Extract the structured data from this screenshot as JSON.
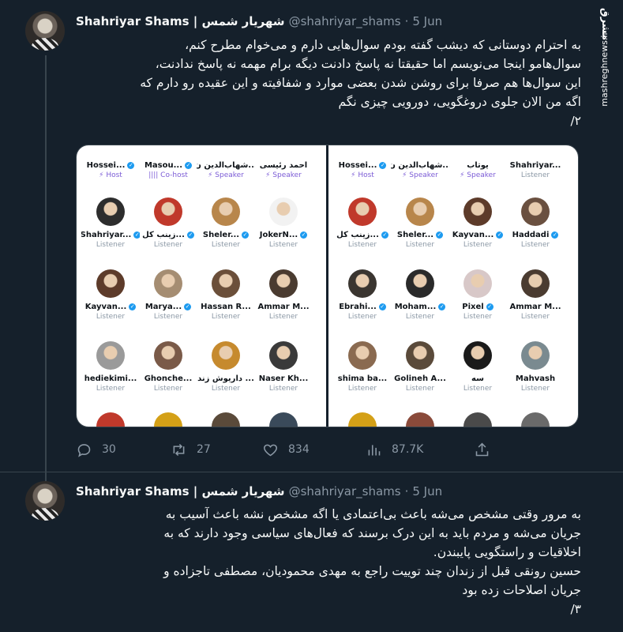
{
  "watermark": {
    "logo": "مشرق",
    "url": "mashreghnews.ir"
  },
  "tweets": [
    {
      "display_name": "Shahriyar Shams | شهریار شمس",
      "handle": "@shahriyar_shams",
      "dot": "·",
      "date": "5 Jun",
      "text": "به احترام دوستانی که دیشب گفته بودم سوال‌هایی دارم و می‌خوام مطرح کنم،\nسوال‌هامو اینجا می‌نویسم اما حقیقتا نه پاسخ دادنت دیگه برام مهمه نه پاسخ ندادنت،\nاین سوال‌ها هم صرفا برای روشن شدن بعضی موارد و شفافیته و این عقیده رو دارم که\nاگه من الان جلوی دروغگویی، دورویی چیزی نگم\n۲/",
      "actions": {
        "reply": "30",
        "retweet": "27",
        "like": "834",
        "views": "87.7K"
      }
    },
    {
      "display_name": "Shahriyar Shams | شهریار شمس",
      "handle": "@shahriyar_shams",
      "dot": "·",
      "date": "5 Jun",
      "text": "به مرور وقتی مشخص می‌شه باعث بی‌اعتمادی یا اگه مشخص نشه باعث آسیب به\nجریان می‌شه و مردم باید به این درک برسند که فعال‌های سیاسی وجود دارند که به\nاخلاقیات و راستگویی پایبندن.\nحسین رونقی قبل از زندان چند توییت راجع به مهدی محمودیان، مصطفی تاجزاده و\nجریان اصلاحات زده بود\n۳/"
    }
  ],
  "media": {
    "left_panel": [
      {
        "name": "Hossei...",
        "role": "Host",
        "verified": true,
        "color": "#3a3a3a"
      },
      {
        "name": "Masou...",
        "role": "Co-host",
        "verified": true,
        "color": "#5a4a3a"
      },
      {
        "name": "شهاب‌الدین ن...",
        "role": "Speaker",
        "verified": false,
        "color": "#7a6a5a"
      },
      {
        "name": "احمد رئیسی",
        "role": "Speaker",
        "verified": false,
        "color": "#4a4a4a"
      },
      {
        "name": "Shahriyar...",
        "role": "Listener",
        "verified": true,
        "color": "#2d2d2d"
      },
      {
        "name": "زینب کل...",
        "role": "Listener",
        "verified": true,
        "color": "#c0392b"
      },
      {
        "name": "Sheler...",
        "role": "Listener",
        "verified": true,
        "color": "#b8864b"
      },
      {
        "name": "JokerN...",
        "role": "Listener",
        "verified": true,
        "color": "#f2f2f2"
      },
      {
        "name": "Kayvan...",
        "role": "Listener",
        "verified": true,
        "color": "#5d3b2a"
      },
      {
        "name": "Marya...",
        "role": "Listener",
        "verified": true,
        "color": "#a58d72"
      },
      {
        "name": "Hassan R...",
        "role": "Listener",
        "verified": false,
        "color": "#6b4f3a"
      },
      {
        "name": "Ammar M...",
        "role": "Listener",
        "verified": false,
        "color": "#4a3b30"
      },
      {
        "name": "hediekimi...",
        "role": "Listener",
        "verified": false,
        "color": "#9a9a9a"
      },
      {
        "name": "Ghonche...",
        "role": "Listener",
        "verified": false,
        "color": "#7a5a48"
      },
      {
        "name": "داریوش زند ...",
        "role": "Listener",
        "verified": false,
        "color": "#c68a2e"
      },
      {
        "name": "Naser Kh...",
        "role": "Listener",
        "verified": false,
        "color": "#3a3a3a"
      }
    ],
    "right_panel": [
      {
        "name": "Hossei...",
        "role": "Host",
        "verified": true,
        "color": "#3a3a3a"
      },
      {
        "name": "شهاب‌الدین ن...",
        "role": "Speaker",
        "verified": false,
        "color": "#7a6a5a"
      },
      {
        "name": "یوتاب",
        "role": "Speaker",
        "verified": false,
        "color": "#8a6a4a"
      },
      {
        "name": "Shahriyar...",
        "role": "Listener",
        "verified": false,
        "color": "#2d2d2d"
      },
      {
        "name": "زینب کل...",
        "role": "Listener",
        "verified": true,
        "color": "#c0392b"
      },
      {
        "name": "Sheler...",
        "role": "Listener",
        "verified": true,
        "color": "#b8864b"
      },
      {
        "name": "Kayvan...",
        "role": "Listener",
        "verified": true,
        "color": "#5d3b2a"
      },
      {
        "name": "Haddadi",
        "role": "Listener",
        "verified": true,
        "color": "#6a5040"
      },
      {
        "name": "Ebrahi...",
        "role": "Listener",
        "verified": true,
        "color": "#3a3530"
      },
      {
        "name": "Moham...",
        "role": "Listener",
        "verified": true,
        "color": "#2a2a2a"
      },
      {
        "name": "Pixel",
        "role": "Listener",
        "verified": true,
        "color": "#d8c8c8"
      },
      {
        "name": "Ammar M...",
        "role": "Listener",
        "verified": false,
        "color": "#4a3b30"
      },
      {
        "name": "shima ba...",
        "role": "Listener",
        "verified": false,
        "color": "#8a6a50"
      },
      {
        "name": "Golineh A...",
        "role": "Listener",
        "verified": false,
        "color": "#5a4a3a"
      },
      {
        "name": "سه",
        "role": "Listener",
        "verified": false,
        "color": "#1a1a1a"
      },
      {
        "name": "Mahvash",
        "role": "Listener",
        "verified": false,
        "color": "#7a8a90"
      }
    ],
    "bottom_row_colors": [
      "#c0392b",
      "#d4a017",
      "#5a4a3a",
      "#3a4a5a",
      "#d4a017",
      "#8a4a3a",
      "#4a4a4a",
      "#6a6a6a"
    ]
  }
}
